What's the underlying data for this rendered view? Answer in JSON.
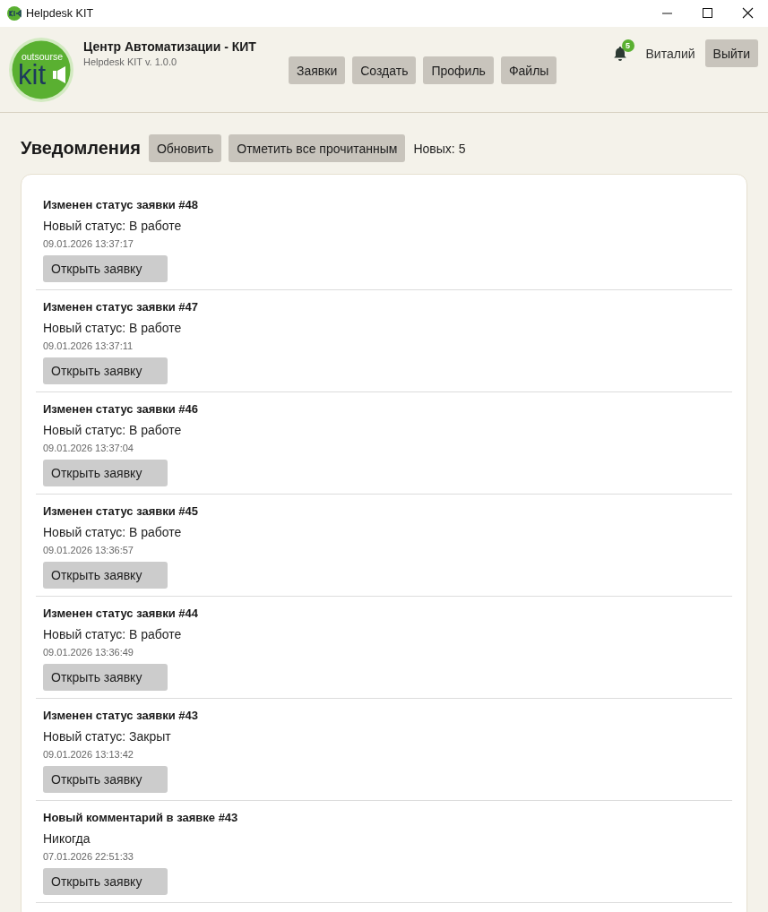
{
  "window": {
    "title": "Helpdesk KIT"
  },
  "header": {
    "logo": {
      "tagline": "outsourse",
      "wordmark": "kit"
    },
    "company": "Центр Автоматизации - КИТ",
    "version": "Helpdesk KIT v. 1.0.0",
    "nav": [
      "Заявки",
      "Создать",
      "Профиль",
      "Файлы"
    ],
    "notification_badge": "5",
    "user": "Виталий",
    "logout": "Выйти"
  },
  "notifications": {
    "title": "Уведомления",
    "actions": [
      "Обновить",
      "Отметить все прочитанным"
    ],
    "new_count": "Новых: 5",
    "items": [
      {
        "title": "Изменен статус заявки #48",
        "body": "Новый статус: В работе",
        "time": "09.01.2026 13:37:17",
        "button": "Открыть заявку"
      },
      {
        "title": "Изменен статус заявки #47",
        "body": "Новый статус: В работе",
        "time": "09.01.2026 13:37:11",
        "button": "Открыть заявку"
      },
      {
        "title": "Изменен статус заявки #46",
        "body": "Новый статус: В работе",
        "time": "09.01.2026 13:37:04",
        "button": "Открыть заявку"
      },
      {
        "title": "Изменен статус заявки #45",
        "body": "Новый статус: В работе",
        "time": "09.01.2026 13:36:57",
        "button": "Открыть заявку"
      },
      {
        "title": "Изменен статус заявки #44",
        "body": "Новый статус: В работе",
        "time": "09.01.2026 13:36:49",
        "button": "Открыть заявку"
      },
      {
        "title": "Изменен статус заявки #43",
        "body": "Новый статус: Закрыт",
        "time": "09.01.2026 13:13:42",
        "button": "Открыть заявку"
      },
      {
        "title": "Новый комментарий в заявке #43",
        "body": "Никогда",
        "time": "07.01.2026 22:51:33",
        "button": "Открыть заявку"
      }
    ]
  }
}
